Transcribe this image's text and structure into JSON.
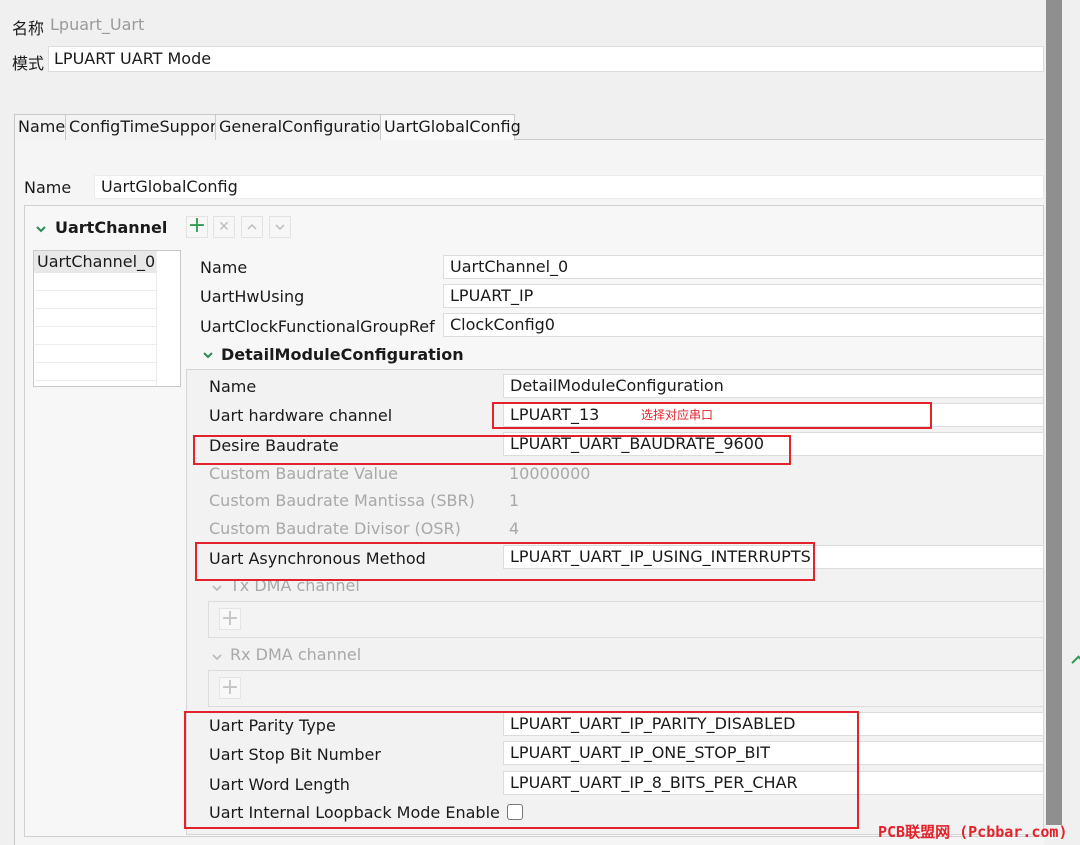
{
  "header": {
    "name_label": "名称",
    "name_value": "Lpuart_Uart",
    "mode_label": "模式",
    "mode_value": "LPUART UART Mode"
  },
  "tabs": [
    {
      "label": "Name"
    },
    {
      "label": "ConfigTimeSupport"
    },
    {
      "label": "GeneralConfiguration"
    },
    {
      "label": "UartGlobalConfig"
    }
  ],
  "global": {
    "name_label": "Name",
    "name_value": "UartGlobalConfig"
  },
  "uart_channel": {
    "section_label": "UartChannel",
    "list_items": [
      "UartChannel_0"
    ],
    "fields": {
      "name_label": "Name",
      "name_value": "UartChannel_0",
      "hw_label": "UartHwUsing",
      "hw_value": "LPUART_IP",
      "clock_label": "UartClockFunctionalGroupRef",
      "clock_value": "ClockConfig0"
    }
  },
  "detail": {
    "section_label": "DetailModuleConfiguration",
    "name_label": "Name",
    "name_value": "DetailModuleConfiguration",
    "hw_channel_label": "Uart hardware channel",
    "hw_channel_value": "LPUART_13",
    "hw_channel_note": "选择对应串口",
    "baud_label": "Desire Baudrate",
    "baud_value": "LPUART_UART_BAUDRATE_9600",
    "custom_baud_label": "Custom Baudrate Value",
    "custom_baud_value": "10000000",
    "mantissa_label": "Custom Baudrate Mantissa (SBR)",
    "mantissa_value": "1",
    "divisor_label": "Custom Baudrate Divisor (OSR)",
    "divisor_value": "4",
    "async_label": "Uart Asynchronous Method",
    "async_value": "LPUART_UART_IP_USING_INTERRUPTS",
    "tx_dma_label": "Tx DMA channel",
    "rx_dma_label": "Rx DMA channel",
    "parity_label": "Uart Parity Type",
    "parity_value": "LPUART_UART_IP_PARITY_DISABLED",
    "stop_label": "Uart Stop Bit Number",
    "stop_value": "LPUART_UART_IP_ONE_STOP_BIT",
    "word_label": "Uart Word Length",
    "word_value": "LPUART_UART_IP_8_BITS_PER_CHAR",
    "loopback_label": "Uart Internal Loopback Mode Enable",
    "loopback_checked": false
  },
  "watermark": "PCB联盟网 (Pcbbar.com)",
  "colors": {
    "annotation_red": "#e3232c",
    "accent_green": "#2e9b52"
  }
}
